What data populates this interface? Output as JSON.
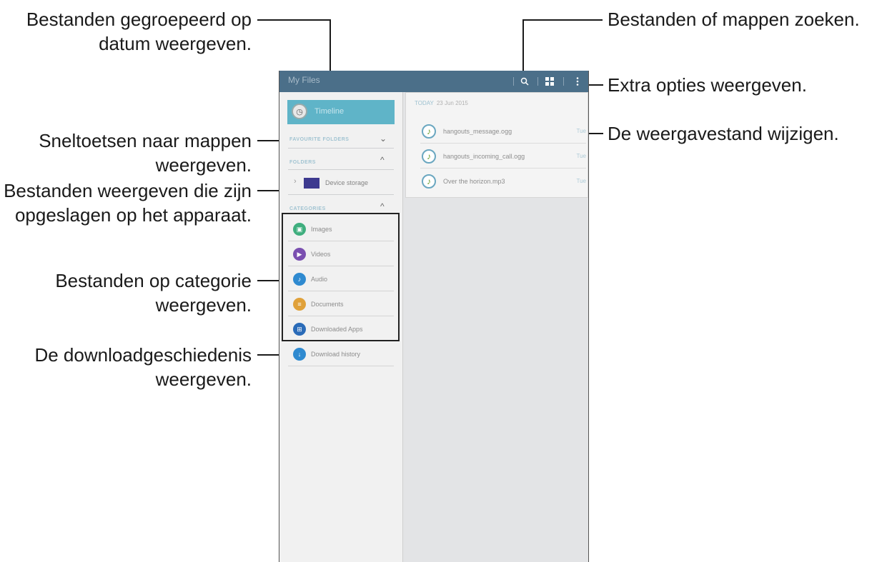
{
  "callouts": {
    "timeline": [
      "Bestanden gegroepeerd op",
      "datum weergeven."
    ],
    "favourites": [
      "Sneltoetsen naar mappen",
      "weergeven."
    ],
    "storage": [
      "Bestanden weergeven die zijn",
      "opgeslagen op het apparaat."
    ],
    "categories": [
      "Bestanden op categorie",
      "weergeven."
    ],
    "download_history": [
      "De downloadgeschiedenis",
      "weergeven."
    ],
    "search": "Bestanden of mappen zoeken.",
    "more": "Extra opties weergeven.",
    "view_mode": "De weergavestand wijzigen."
  },
  "app": {
    "title": "My Files",
    "icons": {
      "search": "search-icon",
      "view": "grid-icon",
      "more": "more-options-icon"
    }
  },
  "sidebar": {
    "timeline_label": "Timeline",
    "favourite_folders": "FAVOURITE FOLDERS",
    "folders": "FOLDERS",
    "device_storage": "Device storage",
    "categories_header": "CATEGORIES",
    "categories": [
      {
        "label": "Images",
        "color": "#3fae7e",
        "glyph": "▣"
      },
      {
        "label": "Videos",
        "color": "#7a4fb0",
        "glyph": "▶"
      },
      {
        "label": "Audio",
        "color": "#2f8ad0",
        "glyph": "♪"
      },
      {
        "label": "Documents",
        "color": "#e0a13a",
        "glyph": "≡"
      },
      {
        "label": "Downloaded Apps",
        "color": "#2a6bb8",
        "glyph": "⊞"
      }
    ],
    "download_history": {
      "label": "Download history",
      "color": "#2f8ad0",
      "glyph": "↓"
    }
  },
  "content": {
    "today_label": "TODAY",
    "date": "23 Jun 2015",
    "files": [
      {
        "name": "hangouts_message.ogg",
        "day": "Tue"
      },
      {
        "name": "hangouts_incoming_call.ogg",
        "day": "Tue"
      },
      {
        "name": "Over the horizon.mp3",
        "day": "Tue"
      }
    ]
  },
  "colors": {
    "appbar": "#4b6f89",
    "timeline_active": "#5fb4c8",
    "accent": "#7fb0c4"
  }
}
